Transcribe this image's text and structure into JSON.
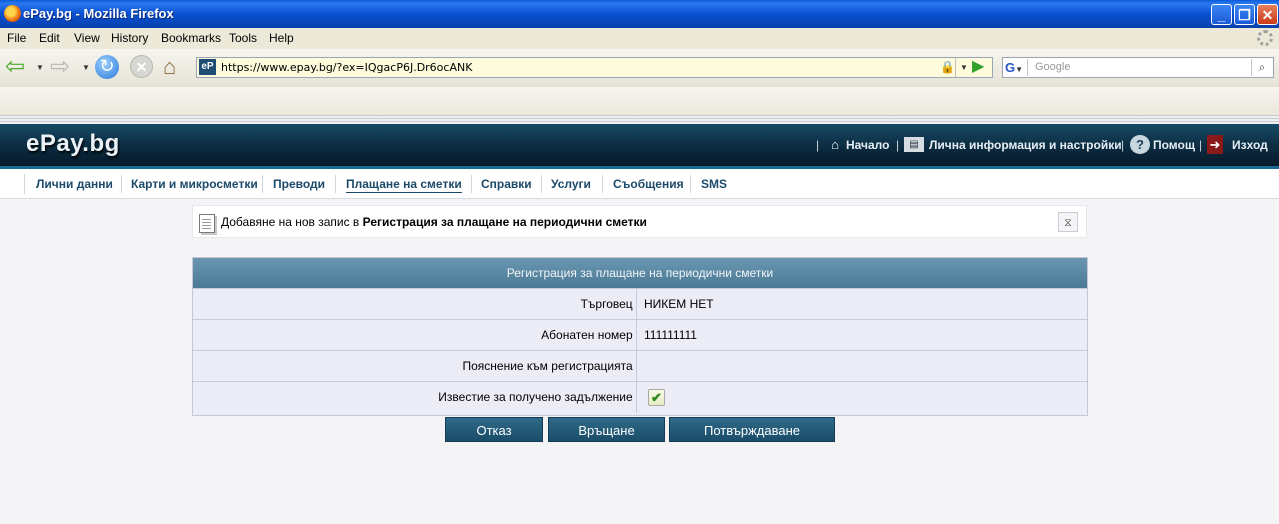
{
  "window": {
    "title": "ePay.bg - Mozilla Firefox"
  },
  "menu": [
    "File",
    "Edit",
    "View",
    "History",
    "Bookmarks",
    "Tools",
    "Help"
  ],
  "browser": {
    "url": "https://www.epay.bg/?ex=IQgacP6J.Dr6ocANK",
    "site_icon_text": "eP",
    "search_placeholder": "Google",
    "search_engine_icon": "G"
  },
  "site": {
    "logo": "ePay.bg",
    "top_links": [
      "Начало",
      "Лична информация и настройки",
      "Помощ",
      "Изход"
    ],
    "tabs": [
      "Лични данни",
      "Карти и микросметки",
      "Преводи",
      "Плащане на сметки",
      "Справки",
      "Услуги",
      "Съобщения",
      "SMS"
    ],
    "active_tab": "Плащане на сметки"
  },
  "notice": {
    "prefix": "Добавяне на нов запис в",
    "bold": "Регистрация за плащане на периодични сметки"
  },
  "form": {
    "title": "Регистрация за плащане на периодични сметки",
    "rows": [
      {
        "label": "Търговец",
        "value": "НИКЕМ НЕТ"
      },
      {
        "label": "Абонатен номер",
        "value": "111111111"
      },
      {
        "label": "Пояснение към регистрацията",
        "value": ""
      },
      {
        "label": "Известие за получено задължение",
        "checked": true
      }
    ]
  },
  "buttons": {
    "cancel": "Отказ",
    "back": "Връщане",
    "confirm": "Потвърждаване"
  },
  "colors": {
    "header_bg": "#0c2c40",
    "button_bg": "#1a4d6a",
    "tab_text": "#1b4a6a",
    "form_head": "#5a88a2"
  }
}
